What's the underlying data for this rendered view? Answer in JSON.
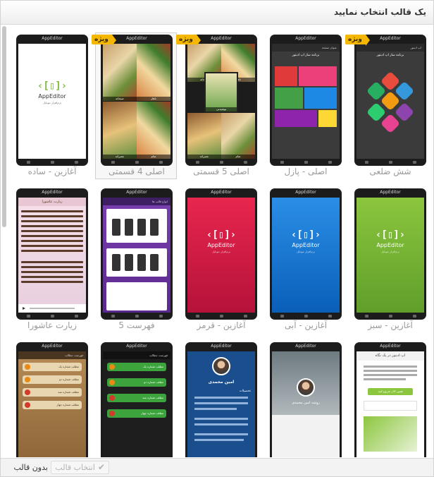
{
  "dialog": {
    "title": "یک قالب انتخاب نمایید"
  },
  "footer": {
    "no_template_label": "بدون قالب",
    "no_template_icon": "close-icon",
    "select_template_label": "انتخاب قالب",
    "select_template_icon": "check-icon"
  },
  "badge_label": "ویژه",
  "app_name": "AppEditor",
  "screens": {
    "splash_sub": "نرم‌افزار موبایل",
    "puzzle_header": "عنوان صفحه",
    "puzzle_title": "برنامه ساز اپ ادیتور",
    "hex_title": "برنامه ساز اپ ادیتور",
    "list_header": "فهرست مطالب",
    "list_items": [
      "مطلب شماره یک",
      "مطلب شماره دو",
      "مطلب شماره سه",
      "مطلب شماره چهار"
    ],
    "profile_name": "امین محمدی",
    "profile_section": "تحصیلات",
    "glance_title": "اپ ادیتور در یک نگاه",
    "glance_button": "همین الان شروع کنید",
    "four_part_cells": [
      "صبحانه",
      "ناهار",
      "عصرانه",
      "شام"
    ],
    "five_part_cells": [
      "صبحانه",
      "ناهار",
      "نوشیدنی",
      "عصرانه",
      "شام"
    ],
    "list5_header": "انواع قالب ها",
    "ashura_header": "زیارت عاشورا",
    "person_name": "روشه امین محمدی"
  },
  "templates": [
    {
      "label": "شش ضلعی",
      "special": true,
      "selected": false
    },
    {
      "label": "اصلی - پازل",
      "special": false,
      "selected": false
    },
    {
      "label": "اصلی 5 قسمتی",
      "special": true,
      "selected": false
    },
    {
      "label": "اصلی 4 قسمتی",
      "special": true,
      "selected": true
    },
    {
      "label": "آغازین - ساده",
      "special": false,
      "selected": false
    },
    {
      "label": "آغازین - سبز",
      "special": false,
      "selected": false
    },
    {
      "label": "آغازین - آبی",
      "special": false,
      "selected": false
    },
    {
      "label": "آغازین - قرمز",
      "special": false,
      "selected": false
    },
    {
      "label": "فهرست 5",
      "special": false,
      "selected": false
    },
    {
      "label": "زیارت عاشورا",
      "special": false,
      "selected": false
    },
    {
      "label": "",
      "special": false,
      "selected": false
    },
    {
      "label": "",
      "special": false,
      "selected": false
    },
    {
      "label": "",
      "special": false,
      "selected": false
    },
    {
      "label": "",
      "special": false,
      "selected": false
    },
    {
      "label": "",
      "special": false,
      "selected": false
    }
  ],
  "colors": {
    "badge": "#f6b700",
    "green_start": "#8cc63e",
    "blue_start": "#2b8ee6",
    "red_start": "#e8264d"
  }
}
